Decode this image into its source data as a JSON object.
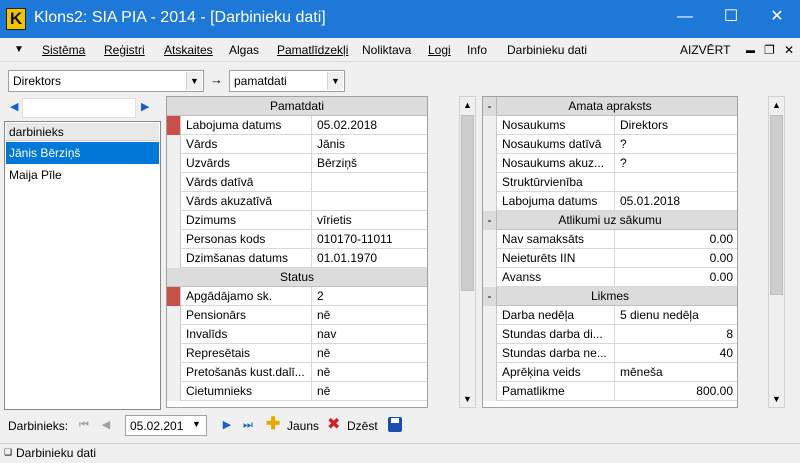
{
  "window": {
    "logo_letter": "K",
    "title": "Klons2: SIA PIA - 2014 - [Darbinieku dati]",
    "minimize_glyph": "—",
    "maximize_glyph": "☐",
    "close_glyph": "✕"
  },
  "menu": {
    "dropdown_glyph": "▼",
    "items": [
      {
        "label": "Sistēma"
      },
      {
        "label": "Reģistri"
      },
      {
        "label": "Atskaites"
      },
      {
        "label": "Algas"
      },
      {
        "label": "Pamatlīdzekļi"
      },
      {
        "label": "Noliktava"
      },
      {
        "label": "Logi"
      },
      {
        "label": "Info"
      },
      {
        "label": "Darbinieku dati"
      }
    ],
    "close_label": "AIZVĒRT",
    "mdi_minimize": "▬",
    "mdi_restore": "❐",
    "mdi_close": "✕"
  },
  "toolbar": {
    "position_value": "Direktors",
    "arrow": "→",
    "view_value": "pamatdati"
  },
  "left": {
    "search_value": "",
    "list_header": "darbinieks",
    "employees": [
      {
        "name": "Jānis Bērziņš",
        "selected": true
      },
      {
        "name": "Maija Pīle",
        "selected": false
      }
    ]
  },
  "basic_data": {
    "section_title": "Pamatdati",
    "rows": [
      {
        "label": "Labojuma datums",
        "value": "05.02.2018"
      },
      {
        "label": "Vārds",
        "value": "Jānis"
      },
      {
        "label": "Uzvārds",
        "value": "Bērziņš"
      },
      {
        "label": "Vārds datīvā",
        "value": ""
      },
      {
        "label": "Vārds akuzatīvā",
        "value": ""
      },
      {
        "label": "Dzimums",
        "value": "vīrietis"
      },
      {
        "label": "Personas kods",
        "value": "010170-11011"
      },
      {
        "label": "Dzimšanas datums",
        "value": "01.01.1970"
      }
    ],
    "status_title": "Status",
    "status_rows": [
      {
        "label": "Apgādājamo sk.",
        "value": "2"
      },
      {
        "label": "Pensionārs",
        "value": "nē"
      },
      {
        "label": "Invalīds",
        "value": "nav"
      },
      {
        "label": "Represētais",
        "value": "nē"
      },
      {
        "label": "Pretošanās kust.dalī...",
        "value": "nē"
      },
      {
        "label": "Cietumnieks",
        "value": "nē"
      }
    ]
  },
  "job": {
    "minus": "-",
    "title": "Amata apraksts",
    "rows": [
      {
        "label": "Nosaukums",
        "value": "Direktors"
      },
      {
        "label": "Nosaukums datīvā",
        "value": "?"
      },
      {
        "label": "Nosaukums akuz...",
        "value": "?"
      },
      {
        "label": "Struktūrvienība",
        "value": ""
      },
      {
        "label": "Labojuma datums",
        "value": "05.01.2018"
      }
    ],
    "balances_title": "Atlikumi uz sākumu",
    "balances": [
      {
        "label": "Nav samaksāts",
        "value": "0.00"
      },
      {
        "label": "Neieturēts IIN",
        "value": "0.00"
      },
      {
        "label": "Avanss",
        "value": "0.00"
      }
    ],
    "rates_title": "Likmes",
    "rates": [
      {
        "label": "Darba nedēļa",
        "value": "5 dienu nedēļa"
      },
      {
        "label": "Stundas darba di...",
        "value": "8"
      },
      {
        "label": "Stundas darba ne...",
        "value": "40"
      },
      {
        "label": "Aprēķina veids",
        "value": "mēneša"
      },
      {
        "label": "Pamatlikme",
        "value": "800.00"
      }
    ]
  },
  "bottom": {
    "label": "Darbinieks:",
    "date_value": "05.02.201",
    "new_label": "Jauns",
    "delete_label": "Dzēst"
  },
  "status": {
    "tab_label": "Darbinieku dati"
  },
  "colors": {
    "title_bar": "#1e78d7",
    "selection": "#0078d7",
    "marker_red": "#c8504a",
    "section_header": "#dcdcdc"
  }
}
